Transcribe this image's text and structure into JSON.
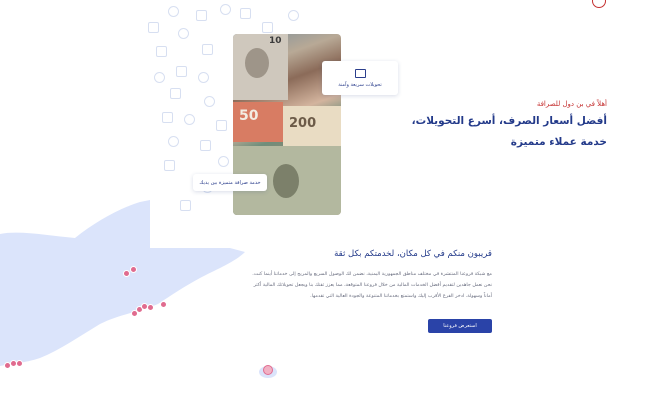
{
  "hero": {
    "welcome": "أهلاً في بن دول للصرافة",
    "headline_line1": "أفضل أسعار الصرف، أسرع التحويلات،",
    "headline_line2": "خدمة عملاء متميزة"
  },
  "cards": {
    "transfers": "تحويلات سريعة وآمنة",
    "exchange": "خدمة صرافة متميزة بين يديك"
  },
  "branches": {
    "title": "قريبون منكم في كل مكان، لخدمتكم بكل ثقة",
    "body": "مع شبكة فروعنا المنتشرة في مختلف مناطق الجمهورية اليمنية، نضمن لك الوصول السريع والمريح إلى خدماتنا أينما كنت. نحن نعمل جاهدين لتقديم أفضل الخدمات المالية من خلال فروعنا المتوقعة، مما يعزز ثقتك بنا ويجعل تحويلاتك المالية أكثر أماناً وسهولة. ادخر الفرع الأقرب إليك واستمتع بخدماتنا المتنوعة والجودة العالية التي تقدمها.",
    "cta_label": "استعرض فروعنا"
  },
  "colors": {
    "brand_blue": "#233a8a",
    "accent_red": "#c53232",
    "button_blue": "#2a43a8",
    "map_fill": "#dbe4fb"
  },
  "icons": {
    "background": "money-pattern-icons",
    "card_transfer": "monitor-icon",
    "map_markers": "map-pin-icon"
  }
}
